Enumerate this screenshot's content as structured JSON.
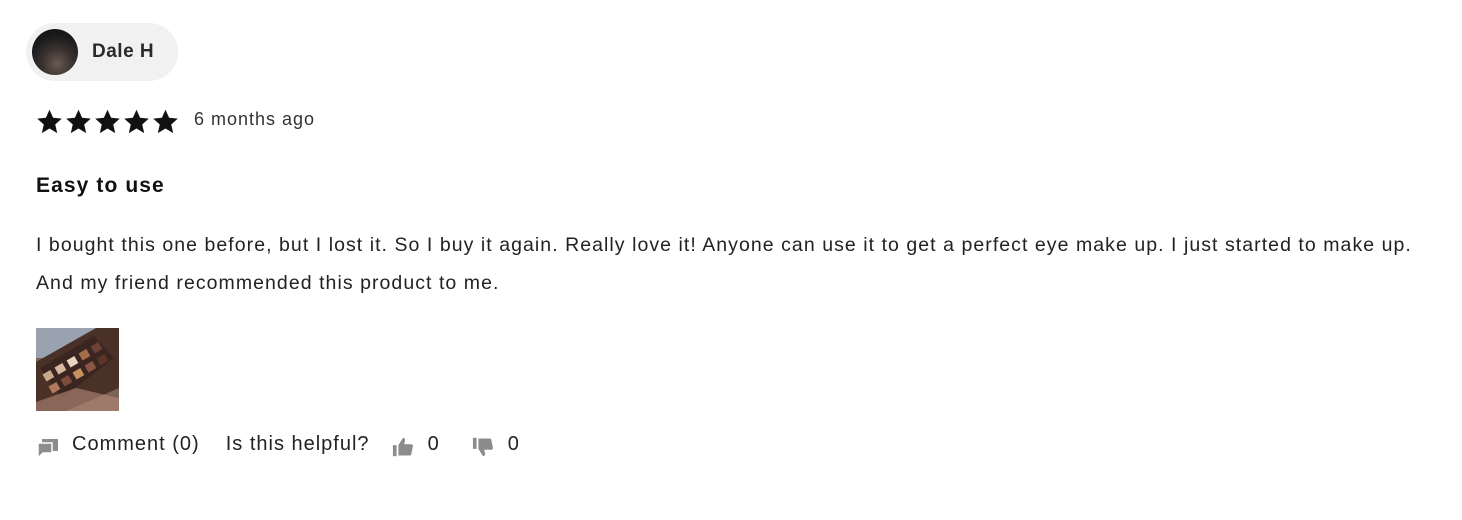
{
  "author": {
    "name": "Dale H",
    "avatar": "user-avatar-photo"
  },
  "rating": {
    "stars": 5,
    "max": 5,
    "icon": "star-icon",
    "color": "#111111"
  },
  "review": {
    "date": "6 months ago",
    "title": "Easy to use",
    "body": "I bought this one before, but I lost it. So I buy it again. Really love it! Anyone can use it to get a perfect eye make up. I just started to make up. And my friend recommended this product to me.",
    "photo": "eyeshadow-palette-photo"
  },
  "actions": {
    "comment_label": "Comment (0)",
    "comment_icon": "comment-icon",
    "helpful_label": "Is this helpful?",
    "upvote_icon": "thumbs-up-icon",
    "upvote_count": "0",
    "downvote_icon": "thumbs-down-icon",
    "downvote_count": "0",
    "icon_color": "#8c8c8c"
  },
  "colors": {
    "chip_background": "#f1f1f1",
    "text": "#222222"
  }
}
